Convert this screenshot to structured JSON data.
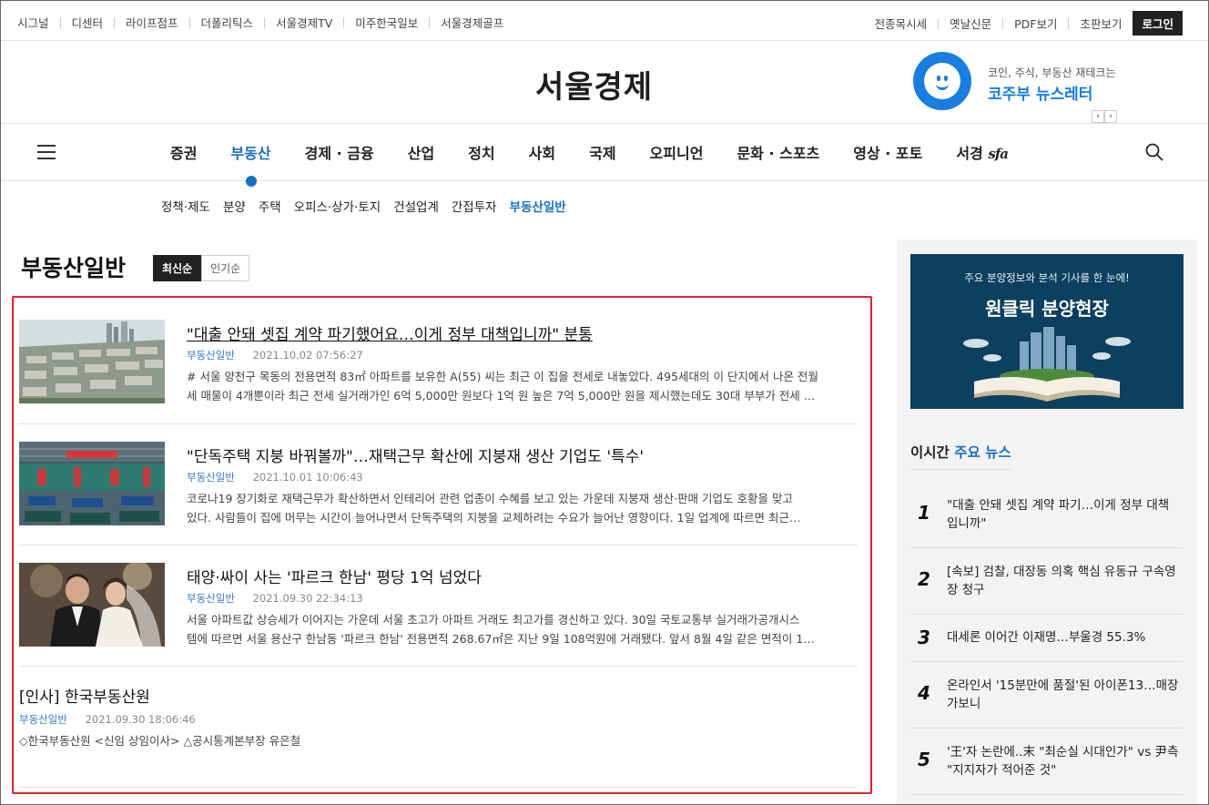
{
  "topbar": {
    "links": [
      "시그널",
      "디센터",
      "라이프점프",
      "더폴리틱스",
      "서울경제TV",
      "미주한국일보",
      "서울경제골프"
    ],
    "right_links": [
      "전종목시세",
      "옛날신문",
      "PDF보기",
      "초판보기"
    ],
    "login": "로그인"
  },
  "masthead": {
    "logo": "서울경제",
    "promo_line1": "코인, 주식, 부동산 재테크는",
    "promo_line2": "코주부 뉴스레터",
    "prev": "‹",
    "next": "›"
  },
  "nav": {
    "items": [
      "증권",
      "부동산",
      "경제 · 금융",
      "산업",
      "정치",
      "사회",
      "국제",
      "오피니언",
      "문화 · 스포츠",
      "영상 · 포토"
    ],
    "active": "부동산",
    "last_label": "서경",
    "last_brand": "sfa"
  },
  "subnav": {
    "items": [
      "정책·제도",
      "분양",
      "주택",
      "오피스·상가·토지",
      "건설업계",
      "간접투자",
      "부동산일반"
    ],
    "active": "부동산일반"
  },
  "section": {
    "title": "부동산일반",
    "sort_latest": "최신순",
    "sort_popular": "인기순"
  },
  "articles": [
    {
      "title": "\"대출 안돼 셋집 계약 파기했어요…이게 정부 대책입니까\" 분통",
      "category": "부동산일반",
      "date": "2021.10.02  07:56:27",
      "body1": "# 서울 양천구 목동의 전용면적 83㎡ 아파트를 보유한 A(55) 씨는 최근 이 집을 전세로 내놓았다. 495세대의 이 단지에서 나온 전월",
      "body2": "세 매물이 4개뿐이라 최근 전세 실거래가인 6억 5,000만 원보다 1억 원 높은 7억 5,000만 원을 제시했는데도 30대 부부가 전세 …"
    },
    {
      "title": "\"단독주택 지붕 바꿔볼까\"…재택근무 확산에 지붕재 생산 기업도 '특수'",
      "category": "부동산일반",
      "date": "2021.10.01  10:06:43",
      "body1": "코로나19 장기화로 재택근무가 확산하면서 인테리어 관련 업종이 수혜를 보고 있는 가운데 지붕재 생산·판매 기업도 호황을 맞고",
      "body2": "있다. 사람들이 집에 머무는 시간이 늘어나면서 단독주택의 지붕을 교체하려는 수요가 늘어난 영향이다. 1일 업계에 따르면 최근…"
    },
    {
      "title": "태양·싸이 사는 '파르크 한남' 평당 1억 넘었다",
      "category": "부동산일반",
      "date": "2021.09.30  22:34:13",
      "body1": "서울 아파트값 상승세가 이어지는 가운데 서울 초고가 아파트 거래도 최고가를 경신하고 있다. 30일 국토교통부 실거래가공개시스",
      "body2": "템에 따르면 서울 용산구 한남동 '파르크 한남' 전용면적 268.67㎡은 지난 9일 108억원에 거래됐다. 앞서 8월 4일 같은 면적이 1…"
    },
    {
      "title": "[인사] 한국부동산원",
      "category": "부동산일반",
      "date": "2021.09.30  18:06:46",
      "body1": "◇한국부동산원 <신임 상임이사> △공시통계본부장 유은철"
    }
  ],
  "sidebar": {
    "ad_line1": "주요 분양정보와 분석 기사를 한 눈에!",
    "ad_line2": "원클릭 분양현장",
    "popular_head_prefix": "이시간 ",
    "popular_head_accent": "주요 뉴스",
    "popular": [
      {
        "num": "1",
        "text": "\"대출 안돼 셋집 계약 파기…이게 정부 대책입니까\""
      },
      {
        "num": "2",
        "text": "[속보] 검찰, 대장동 의혹 핵심 유동규 구속영장 청구"
      },
      {
        "num": "3",
        "text": "대세론 이어간 이재명…부울경 55.3%"
      },
      {
        "num": "4",
        "text": "온라인서 '15분만에 품절'된 아이폰13…매장 가보니"
      },
      {
        "num": "5",
        "text": "'王'자 논란에..末 \"최순실 시대인가\" vs 尹측 \"지지자가 적어준 것\""
      }
    ]
  }
}
